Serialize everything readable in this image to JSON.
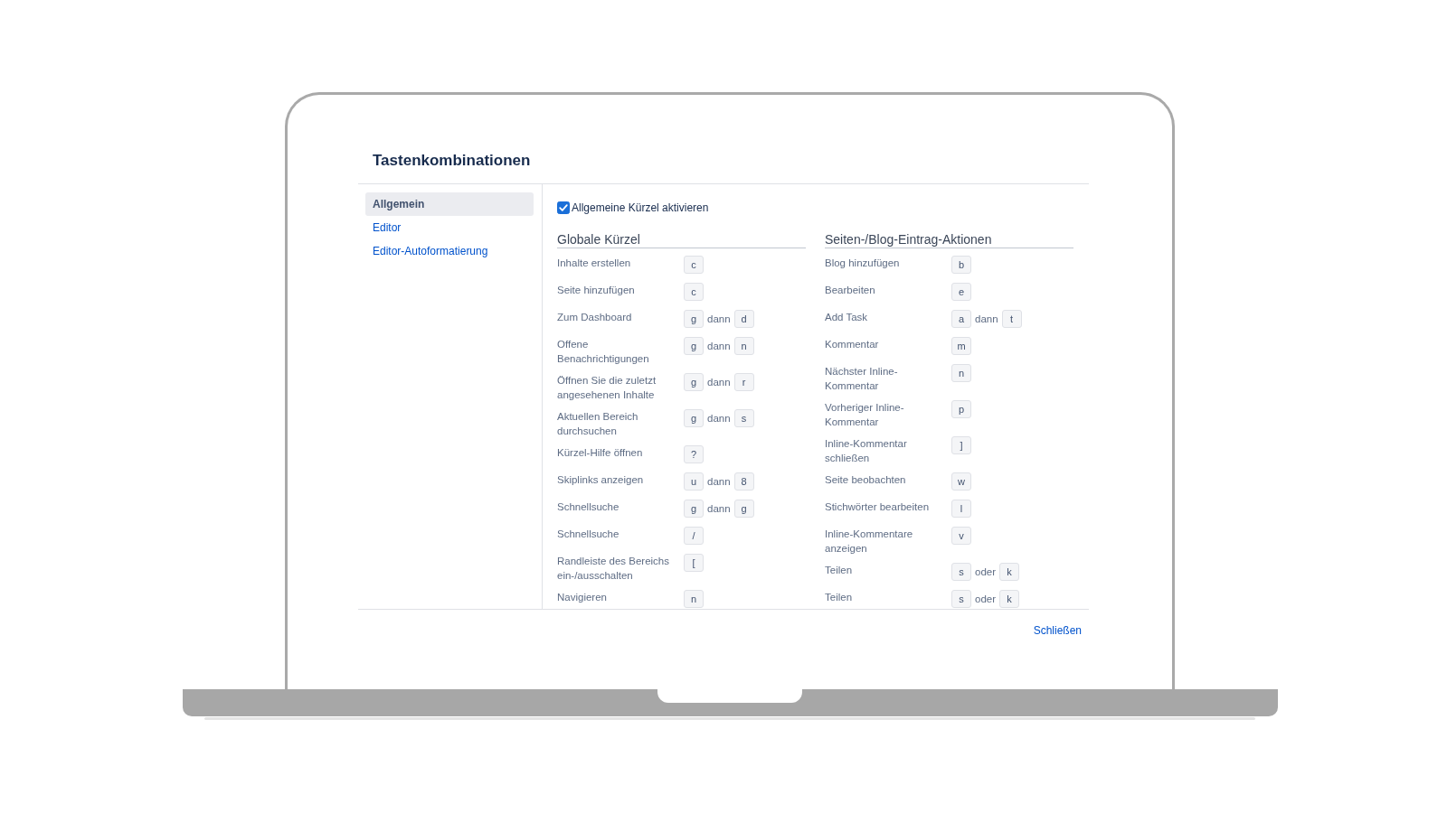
{
  "dialog": {
    "title": "Tastenkombinationen"
  },
  "sidebar": {
    "items": [
      {
        "label": "Allgemein",
        "selected": true
      },
      {
        "label": "Editor",
        "selected": false
      },
      {
        "label": "Editor-Autoformatierung",
        "selected": false
      }
    ]
  },
  "enable_option": {
    "label": "Allgemeine Kürzel aktivieren",
    "checked": true
  },
  "sections": [
    {
      "heading": "Globale Kürzel",
      "shortcuts": [
        {
          "label": "Inhalte erstellen",
          "keys": [
            "c"
          ]
        },
        {
          "label": "Seite hinzufügen",
          "keys": [
            "c"
          ]
        },
        {
          "label": "Zum Dashboard",
          "keys": [
            "g",
            "d"
          ],
          "joiner": "dann"
        },
        {
          "label": "Offene Benachrichtigungen",
          "keys": [
            "g",
            "n"
          ],
          "joiner": "dann"
        },
        {
          "label": "Öffnen Sie die zuletzt angesehenen Inhalte",
          "keys": [
            "g",
            "r"
          ],
          "joiner": "dann"
        },
        {
          "label": "Aktuellen Bereich durchsuchen",
          "keys": [
            "g",
            "s"
          ],
          "joiner": "dann"
        },
        {
          "label": "Kürzel-Hilfe öffnen",
          "keys": [
            "?"
          ]
        },
        {
          "label": "Skiplinks anzeigen",
          "keys": [
            "u",
            "8"
          ],
          "joiner": "dann"
        },
        {
          "label": "Schnellsuche",
          "keys": [
            "g",
            "g"
          ],
          "joiner": "dann"
        },
        {
          "label": "Schnellsuche",
          "keys": [
            "/"
          ]
        },
        {
          "label": "Randleiste des Bereichs ein-/ausschalten",
          "keys": [
            "["
          ]
        },
        {
          "label": "Navigieren",
          "keys": [
            "n"
          ]
        }
      ]
    },
    {
      "heading": "Seiten-/Blog-Eintrag-Aktionen",
      "shortcuts": [
        {
          "label": "Blog hinzufügen",
          "keys": [
            "b"
          ]
        },
        {
          "label": "Bearbeiten",
          "keys": [
            "e"
          ]
        },
        {
          "label": "Add Task",
          "keys": [
            "a",
            "t"
          ],
          "joiner": "dann"
        },
        {
          "label": "Kommentar",
          "keys": [
            "m"
          ]
        },
        {
          "label": "Nächster Inline-Kommentar",
          "keys": [
            "n"
          ]
        },
        {
          "label": "Vorheriger Inline-Kommentar",
          "keys": [
            "p"
          ]
        },
        {
          "label": "Inline-Kommentar schließen",
          "keys": [
            "]"
          ]
        },
        {
          "label": "Seite beobachten",
          "keys": [
            "w"
          ]
        },
        {
          "label": "Stichwörter bearbeiten",
          "keys": [
            "l"
          ]
        },
        {
          "label": "Inline-Kommentare anzeigen",
          "keys": [
            "v"
          ]
        },
        {
          "label": "Teilen",
          "keys": [
            "s",
            "k"
          ],
          "joiner": "oder"
        },
        {
          "label": "Teilen",
          "keys": [
            "s",
            "k"
          ],
          "joiner": "oder"
        }
      ]
    }
  ],
  "footer": {
    "close_link": "Schließen"
  }
}
